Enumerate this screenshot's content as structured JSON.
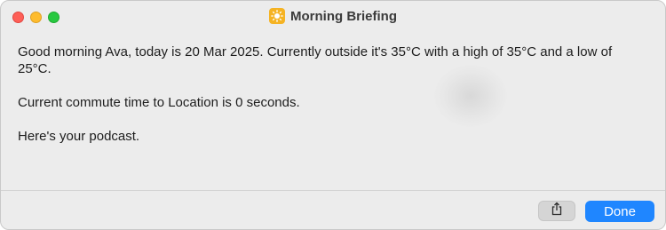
{
  "window": {
    "title": "Morning Briefing",
    "app_icon": "sun-icon"
  },
  "message": {
    "line1": "Good morning Ava, today is 20 Mar 2025.  Currently outside it's 35°C with a high of 35°C and a low of 25°C.",
    "line2": "Current commute time to Location is 0 seconds.",
    "line3": "Here's your podcast."
  },
  "footer": {
    "share_icon": "share-icon",
    "done_label": "Done"
  },
  "colors": {
    "accent": "#1f86ff",
    "app_icon_bg": "#f5b323"
  }
}
